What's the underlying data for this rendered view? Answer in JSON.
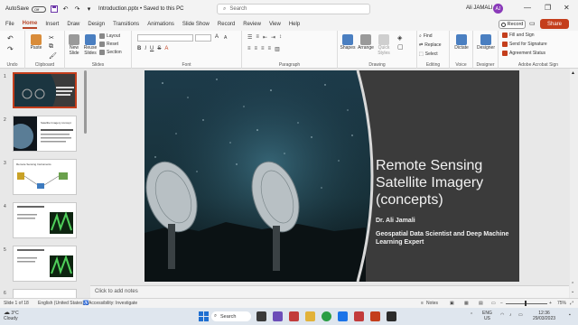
{
  "titlebar": {
    "autosave_label": "AutoSave",
    "autosave_state": "Off",
    "doc_name": "Introduction.pptx • Saved to this PC",
    "search_placeholder": "Search",
    "user_name": "Ali JAMALI",
    "user_initials": "AJ"
  },
  "menu": {
    "tabs": [
      "File",
      "Home",
      "Insert",
      "Draw",
      "Design",
      "Transitions",
      "Animations",
      "Slide Show",
      "Record",
      "Review",
      "View",
      "Help"
    ],
    "active_tab": "Home",
    "record_label": "Record",
    "share_label": "Share"
  },
  "ribbon": {
    "undo_label": "Undo",
    "clipboard": {
      "paste": "Paste",
      "group": "Clipboard"
    },
    "slides": {
      "new_slide": "New Slide",
      "reuse_slides": "Reuse Slides",
      "layout": "Layout",
      "reset": "Reset",
      "section": "Section",
      "group": "Slides"
    },
    "font_group": "Font",
    "paragraph_group": "Paragraph",
    "drawing": {
      "shapes": "Shapes",
      "arrange": "Arrange",
      "quick_styles": "Quick Styles",
      "group": "Drawing"
    },
    "editing": {
      "find": "Find",
      "replace": "Replace",
      "select": "Select",
      "group": "Editing"
    },
    "voice": {
      "dictate": "Dictate",
      "group": "Voice"
    },
    "designer": {
      "designer": "Designer",
      "group": "Designer"
    },
    "adobe": {
      "fill_sign": "Fill and Sign",
      "send_signature": "Send for Signature",
      "agreement_status": "Agreement Status",
      "group": "Adobe Acrobat Sign"
    }
  },
  "thumbnails": {
    "numbers": [
      "1",
      "2",
      "3",
      "4",
      "5",
      "6"
    ],
    "selected": "1",
    "slide2_title": "Satellite Imagery concept",
    "slide3_title": "Remote Sensing Instruments"
  },
  "slide": {
    "title": "Remote Sensing Satellite Imagery (concepts)",
    "author": "Dr. Ali Jamali",
    "role": "Geospatial Data Scientist and Deep Machine Learning Expert"
  },
  "notes_placeholder": "Click to add notes",
  "statusbar": {
    "slide_info": "Slide 1 of 18",
    "language": "English (United States)",
    "accessibility": "Accessibility: Investigate",
    "notes": "Notes",
    "zoom": "75%"
  },
  "taskbar": {
    "temperature": "3°C",
    "weather": "Cloudy",
    "search": "Search",
    "lang": "ENG",
    "region": "US",
    "time": "12:36",
    "date": "29/03/2023"
  },
  "colors": {
    "accent": "#c43e1c",
    "slide_bg": "#3b3b3b",
    "sky_top": "#1d3b4a",
    "sky_bottom": "#0c1518"
  }
}
